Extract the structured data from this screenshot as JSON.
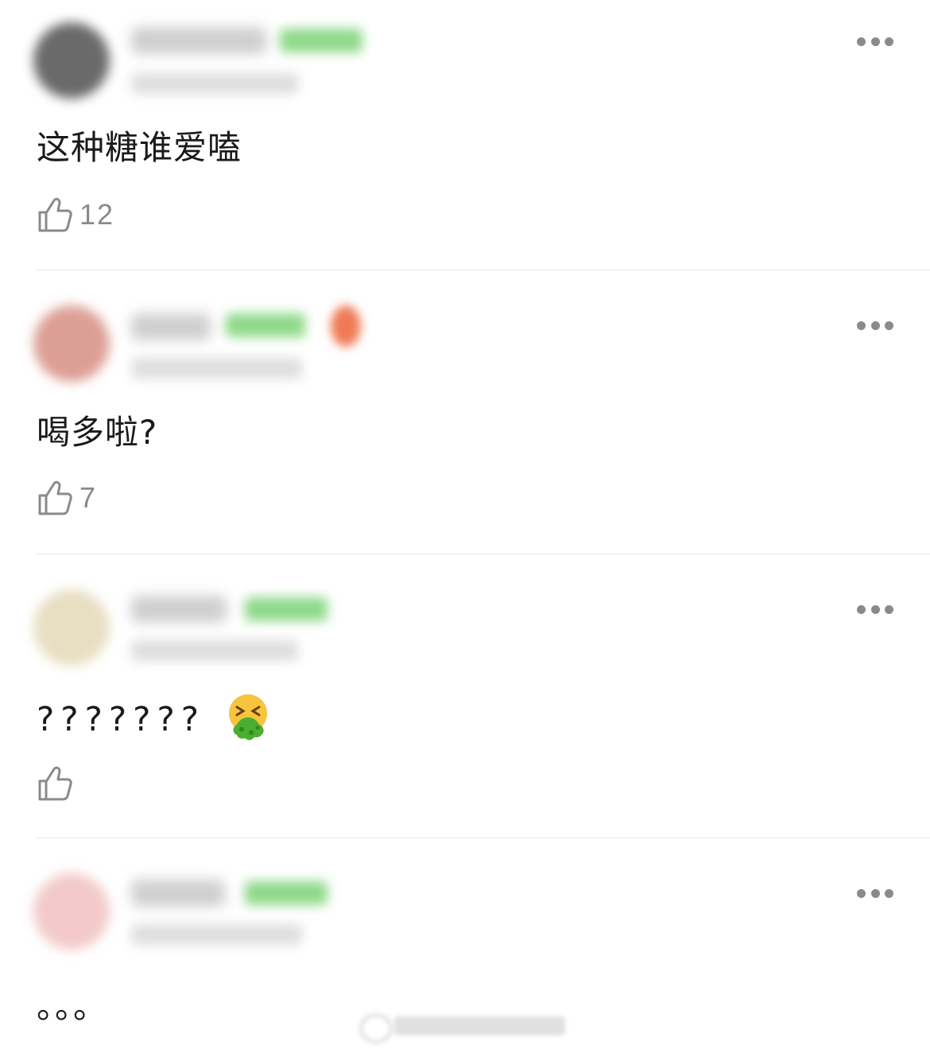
{
  "comments": [
    {
      "text": "这种糖谁爱嗑",
      "likes": "12",
      "avatar_color": "#555555",
      "reactions": []
    },
    {
      "text": "喝多啦?",
      "likes": "7",
      "avatar_color": "#e0a090",
      "reactions": []
    },
    {
      "text": "???????",
      "likes": "",
      "avatar_color": "#e8e0c0",
      "reactions": [
        "vomiting-face-emoji"
      ]
    },
    {
      "text": "。。。",
      "likes": "",
      "avatar_color": "#f2c6c6",
      "reactions": []
    }
  ],
  "icons": {
    "like": "thumbs-up-outline-icon",
    "more": "more-horizontal-icon"
  },
  "colors": {
    "text": "#1a1a1a",
    "secondary": "#8a8a8a",
    "level_badge": "#8fd98a",
    "divider": "#e6e6e6"
  }
}
